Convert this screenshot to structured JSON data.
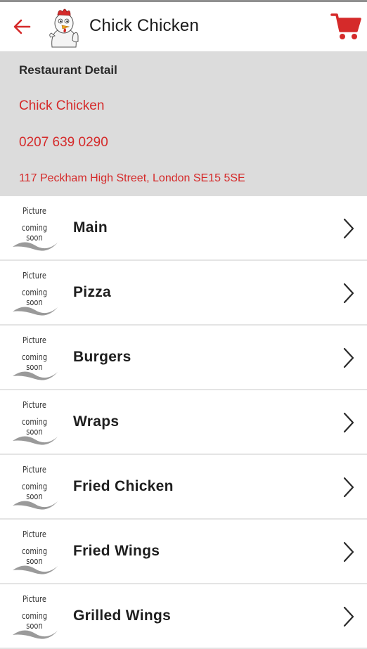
{
  "header": {
    "title": "Chick Chicken",
    "accent": "#d52a2a"
  },
  "restaurant": {
    "heading": "Restaurant Detail",
    "name": "Chick Chicken",
    "phone": "0207 639 0290",
    "address": "117 Peckham High Street, London SE15 5SE"
  },
  "placeholder": {
    "line1": "Picture",
    "line2": "coming soon"
  },
  "menu": {
    "items": [
      {
        "label": "Main"
      },
      {
        "label": "Pizza"
      },
      {
        "label": "Burgers"
      },
      {
        "label": "Wraps"
      },
      {
        "label": "Fried Chicken"
      },
      {
        "label": "Fried Wings"
      },
      {
        "label": "Grilled Wings"
      }
    ]
  },
  "icons": {
    "back": "back-arrow-icon",
    "cart": "cart-icon",
    "chevron": "chevron-right-icon"
  }
}
